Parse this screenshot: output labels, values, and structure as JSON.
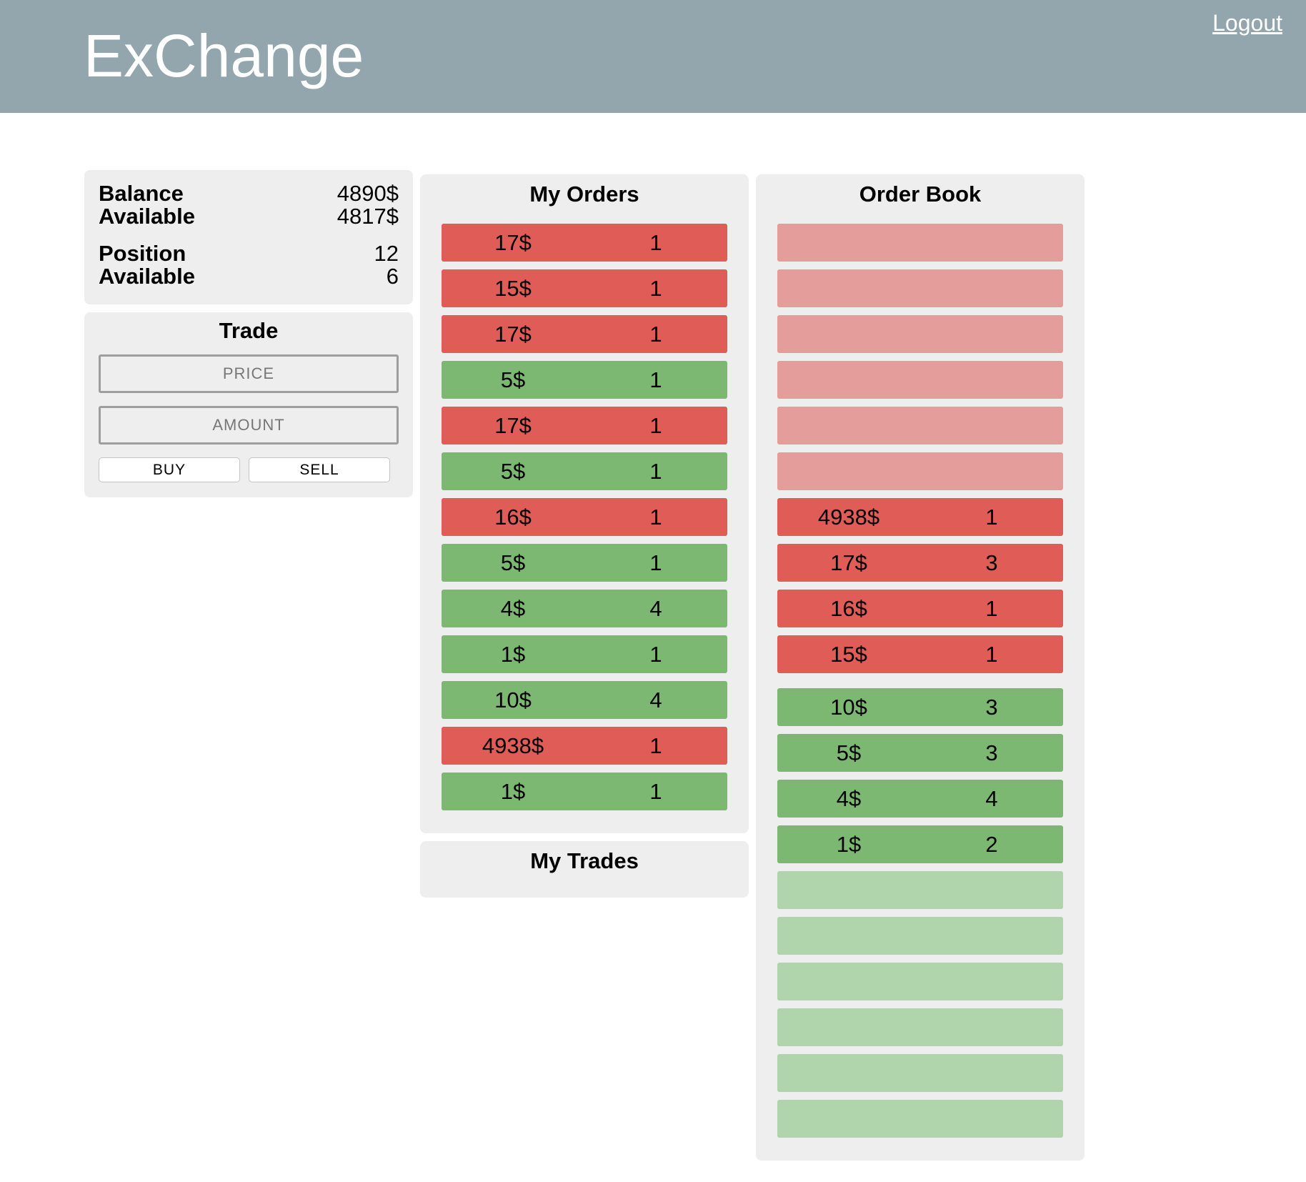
{
  "header": {
    "title": "ExChange",
    "logout_label": "Logout"
  },
  "balance": {
    "balance_label": "Balance",
    "balance_value": "4890$",
    "balance_available_label": "Available",
    "balance_available_value": "4817$",
    "position_label": "Position",
    "position_value": "12",
    "position_available_label": "Available",
    "position_available_value": "6"
  },
  "trade": {
    "heading": "Trade",
    "price_placeholder": "PRICE",
    "amount_placeholder": "AMOUNT",
    "buy_label": "BUY",
    "sell_label": "SELL"
  },
  "my_orders": {
    "heading": "My Orders",
    "rows": [
      {
        "side": "sell",
        "price": "17$",
        "amount": "1"
      },
      {
        "side": "sell",
        "price": "15$",
        "amount": "1"
      },
      {
        "side": "sell",
        "price": "17$",
        "amount": "1"
      },
      {
        "side": "buy",
        "price": "5$",
        "amount": "1"
      },
      {
        "side": "sell",
        "price": "17$",
        "amount": "1"
      },
      {
        "side": "buy",
        "price": "5$",
        "amount": "1"
      },
      {
        "side": "sell",
        "price": "16$",
        "amount": "1"
      },
      {
        "side": "buy",
        "price": "5$",
        "amount": "1"
      },
      {
        "side": "buy",
        "price": "4$",
        "amount": "4"
      },
      {
        "side": "buy",
        "price": "1$",
        "amount": "1"
      },
      {
        "side": "buy",
        "price": "10$",
        "amount": "4"
      },
      {
        "side": "sell",
        "price": "4938$",
        "amount": "1"
      },
      {
        "side": "buy",
        "price": "1$",
        "amount": "1"
      }
    ]
  },
  "my_trades": {
    "heading": "My Trades"
  },
  "order_book": {
    "heading": "Order Book",
    "empty_sell_slots": 6,
    "sells": [
      {
        "price": "4938$",
        "amount": "1"
      },
      {
        "price": "17$",
        "amount": "3"
      },
      {
        "price": "16$",
        "amount": "1"
      },
      {
        "price": "15$",
        "amount": "1"
      }
    ],
    "buys": [
      {
        "price": "10$",
        "amount": "3"
      },
      {
        "price": "5$",
        "amount": "3"
      },
      {
        "price": "4$",
        "amount": "4"
      },
      {
        "price": "1$",
        "amount": "2"
      }
    ],
    "empty_buy_slots": 6
  },
  "colors": {
    "header_bg": "#93a5ad",
    "panel_bg": "#eeeeee",
    "sell_row": "#df5c57",
    "buy_row": "#7cb872",
    "sell_empty": "#e49d9a",
    "buy_empty": "#b0d4ab"
  }
}
